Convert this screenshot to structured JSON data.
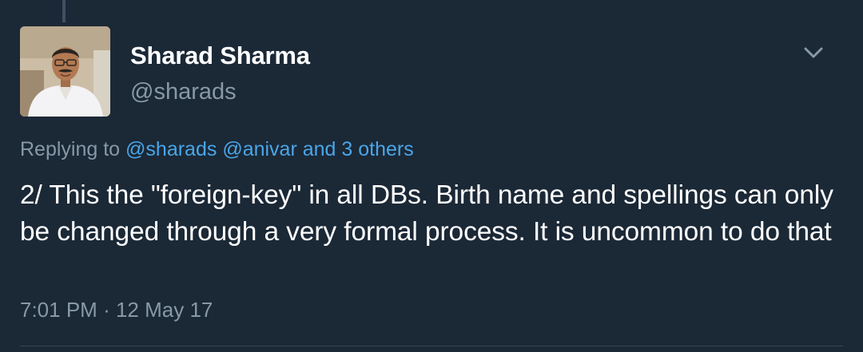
{
  "author": {
    "display_name": "Sharad Sharma",
    "handle": "@sharads"
  },
  "reply": {
    "prefix": "Replying to",
    "mentions": [
      "@sharads",
      "@anivar"
    ],
    "connector": "and",
    "others": "3 others"
  },
  "tweet": {
    "text": "2/ This the \"foreign-key\" in all DBs. Birth name and spellings can only be changed through a very formal process. It is uncommon to do that",
    "time": "7:01 PM",
    "separator": "·",
    "date": "12 May 17"
  },
  "icons": {
    "menu": "chevron-down-icon",
    "avatar": "profile-photo"
  },
  "colors": {
    "background": "#1b2836",
    "primary_text": "#ffffff",
    "secondary_text": "#8899a6",
    "link": "#4aa6e8"
  }
}
